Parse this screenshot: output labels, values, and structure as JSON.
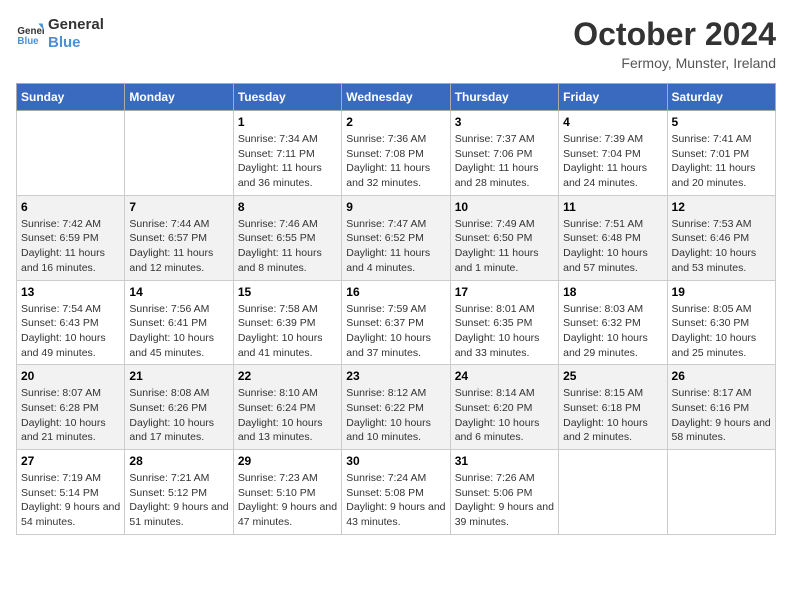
{
  "logo": {
    "line1": "General",
    "line2": "Blue"
  },
  "title": "October 2024",
  "subtitle": "Fermoy, Munster, Ireland",
  "days_of_week": [
    "Sunday",
    "Monday",
    "Tuesday",
    "Wednesday",
    "Thursday",
    "Friday",
    "Saturday"
  ],
  "weeks": [
    [
      {
        "day": "",
        "data": ""
      },
      {
        "day": "",
        "data": ""
      },
      {
        "day": "1",
        "data": "Sunrise: 7:34 AM\nSunset: 7:11 PM\nDaylight: 11 hours and 36 minutes."
      },
      {
        "day": "2",
        "data": "Sunrise: 7:36 AM\nSunset: 7:08 PM\nDaylight: 11 hours and 32 minutes."
      },
      {
        "day": "3",
        "data": "Sunrise: 7:37 AM\nSunset: 7:06 PM\nDaylight: 11 hours and 28 minutes."
      },
      {
        "day": "4",
        "data": "Sunrise: 7:39 AM\nSunset: 7:04 PM\nDaylight: 11 hours and 24 minutes."
      },
      {
        "day": "5",
        "data": "Sunrise: 7:41 AM\nSunset: 7:01 PM\nDaylight: 11 hours and 20 minutes."
      }
    ],
    [
      {
        "day": "6",
        "data": "Sunrise: 7:42 AM\nSunset: 6:59 PM\nDaylight: 11 hours and 16 minutes."
      },
      {
        "day": "7",
        "data": "Sunrise: 7:44 AM\nSunset: 6:57 PM\nDaylight: 11 hours and 12 minutes."
      },
      {
        "day": "8",
        "data": "Sunrise: 7:46 AM\nSunset: 6:55 PM\nDaylight: 11 hours and 8 minutes."
      },
      {
        "day": "9",
        "data": "Sunrise: 7:47 AM\nSunset: 6:52 PM\nDaylight: 11 hours and 4 minutes."
      },
      {
        "day": "10",
        "data": "Sunrise: 7:49 AM\nSunset: 6:50 PM\nDaylight: 11 hours and 1 minute."
      },
      {
        "day": "11",
        "data": "Sunrise: 7:51 AM\nSunset: 6:48 PM\nDaylight: 10 hours and 57 minutes."
      },
      {
        "day": "12",
        "data": "Sunrise: 7:53 AM\nSunset: 6:46 PM\nDaylight: 10 hours and 53 minutes."
      }
    ],
    [
      {
        "day": "13",
        "data": "Sunrise: 7:54 AM\nSunset: 6:43 PM\nDaylight: 10 hours and 49 minutes."
      },
      {
        "day": "14",
        "data": "Sunrise: 7:56 AM\nSunset: 6:41 PM\nDaylight: 10 hours and 45 minutes."
      },
      {
        "day": "15",
        "data": "Sunrise: 7:58 AM\nSunset: 6:39 PM\nDaylight: 10 hours and 41 minutes."
      },
      {
        "day": "16",
        "data": "Sunrise: 7:59 AM\nSunset: 6:37 PM\nDaylight: 10 hours and 37 minutes."
      },
      {
        "day": "17",
        "data": "Sunrise: 8:01 AM\nSunset: 6:35 PM\nDaylight: 10 hours and 33 minutes."
      },
      {
        "day": "18",
        "data": "Sunrise: 8:03 AM\nSunset: 6:32 PM\nDaylight: 10 hours and 29 minutes."
      },
      {
        "day": "19",
        "data": "Sunrise: 8:05 AM\nSunset: 6:30 PM\nDaylight: 10 hours and 25 minutes."
      }
    ],
    [
      {
        "day": "20",
        "data": "Sunrise: 8:07 AM\nSunset: 6:28 PM\nDaylight: 10 hours and 21 minutes."
      },
      {
        "day": "21",
        "data": "Sunrise: 8:08 AM\nSunset: 6:26 PM\nDaylight: 10 hours and 17 minutes."
      },
      {
        "day": "22",
        "data": "Sunrise: 8:10 AM\nSunset: 6:24 PM\nDaylight: 10 hours and 13 minutes."
      },
      {
        "day": "23",
        "data": "Sunrise: 8:12 AM\nSunset: 6:22 PM\nDaylight: 10 hours and 10 minutes."
      },
      {
        "day": "24",
        "data": "Sunrise: 8:14 AM\nSunset: 6:20 PM\nDaylight: 10 hours and 6 minutes."
      },
      {
        "day": "25",
        "data": "Sunrise: 8:15 AM\nSunset: 6:18 PM\nDaylight: 10 hours and 2 minutes."
      },
      {
        "day": "26",
        "data": "Sunrise: 8:17 AM\nSunset: 6:16 PM\nDaylight: 9 hours and 58 minutes."
      }
    ],
    [
      {
        "day": "27",
        "data": "Sunrise: 7:19 AM\nSunset: 5:14 PM\nDaylight: 9 hours and 54 minutes."
      },
      {
        "day": "28",
        "data": "Sunrise: 7:21 AM\nSunset: 5:12 PM\nDaylight: 9 hours and 51 minutes."
      },
      {
        "day": "29",
        "data": "Sunrise: 7:23 AM\nSunset: 5:10 PM\nDaylight: 9 hours and 47 minutes."
      },
      {
        "day": "30",
        "data": "Sunrise: 7:24 AM\nSunset: 5:08 PM\nDaylight: 9 hours and 43 minutes."
      },
      {
        "day": "31",
        "data": "Sunrise: 7:26 AM\nSunset: 5:06 PM\nDaylight: 9 hours and 39 minutes."
      },
      {
        "day": "",
        "data": ""
      },
      {
        "day": "",
        "data": ""
      }
    ]
  ]
}
